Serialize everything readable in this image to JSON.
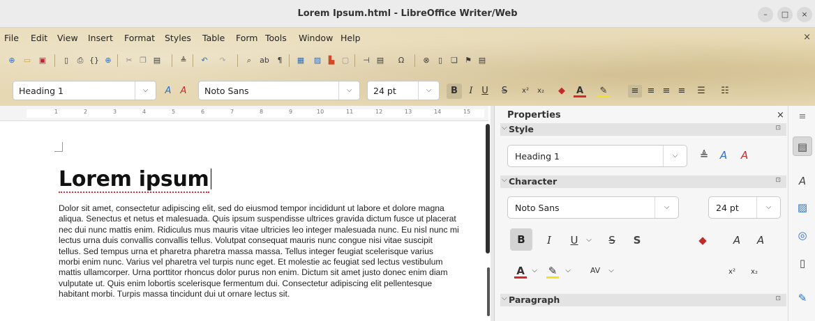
{
  "window": {
    "title": "Lorem Ipsum.html - LibreOffice Writer/Web"
  },
  "window_controls": {
    "minimize": "–",
    "maximize": "□",
    "close": "×"
  },
  "menu": [
    "File",
    "Edit",
    "View",
    "Insert",
    "Format",
    "Styles",
    "Table",
    "Form",
    "Tools",
    "Window",
    "Help"
  ],
  "menu_close": "×",
  "format_toolbar": {
    "paragraph_style": "Heading 1",
    "font_name": "Noto Sans",
    "font_size": "24 pt",
    "bold": "B",
    "italic": "I",
    "underline": "U",
    "strike": "S",
    "superscript": "x²",
    "subscript": "x₂"
  },
  "ruler": [
    "1",
    "2",
    "3",
    "4",
    "5",
    "6",
    "7",
    "8",
    "9",
    "10",
    "11",
    "12",
    "13",
    "14",
    "15"
  ],
  "document": {
    "heading": "Lorem ipsum",
    "body_lines": [
      "Dolor sit amet, consectetur adipiscing elit, sed do eiusmod tempor incididunt ut labore et dolore magna",
      "aliqua. Senectus et netus et malesuada. Quis ipsum suspendisse ultrices gravida dictum fusce ut placerat",
      "nec dui nunc mattis enim. Ridiculus mus mauris vitae ultricies leo integer malesuada nunc. Eu nisl nunc mi",
      "lectus urna duis convallis convallis tellus. Volutpat consequat mauris nunc congue nisi vitae suscipit",
      "tellus. Sed tempus urna et pharetra pharetra massa massa. Tellus integer feugiat scelerisque varius",
      "morbi enim nunc. Varius vel pharetra vel turpis nunc eget. Et molestie ac feugiat sed lectus vestibulum",
      "mattis ullamcorper. Urna porttitor rhoncus dolor purus non enim. Dictum sit amet justo donec enim diam",
      "vulputate ut. Quis enim lobortis scelerisque fermentum dui. Consectetur adipiscing elit pellentesque",
      "habitant morbi. Turpis massa tincidunt dui ut ornare lectus sit."
    ]
  },
  "sidebar": {
    "title": "Properties",
    "close": "×",
    "menu": "≡",
    "style_panel": {
      "label": "Style",
      "style_value": "Heading 1"
    },
    "character_panel": {
      "label": "Character",
      "font_name": "Noto Sans",
      "font_size": "24 pt",
      "bold": "B",
      "italic": "I",
      "underline": "U",
      "strike": "S",
      "shadow": "S",
      "superscript": "x²",
      "subscript": "x₂"
    },
    "paragraph_panel": {
      "label": "Paragraph"
    }
  },
  "colors": {
    "accent_red": "#e0222b",
    "highlight_yellow": "#f5e21d",
    "parchment": "#e4d5ae"
  }
}
